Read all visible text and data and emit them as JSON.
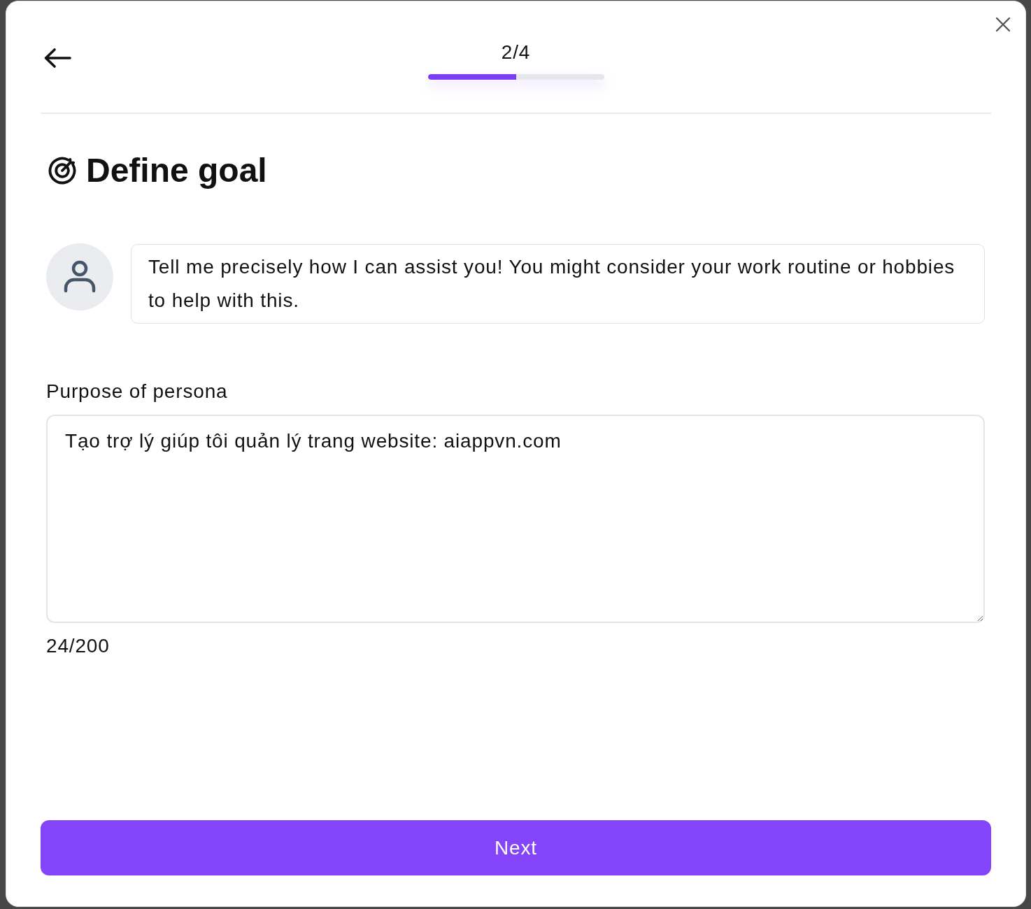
{
  "header": {
    "step": "2/4",
    "progress": {
      "level": 0.5
    }
  },
  "title": "Define goal",
  "assistant_message": "Tell me precisely how I can assist you! You might consider your work routine or hobbies to help with this.",
  "purpose": {
    "label": "Purpose of persona",
    "value": "Tạo trợ lý giúp tôi quản lý trang website: aiappvn.com",
    "counter": "24/200"
  },
  "next_button": {
    "label": "Next"
  }
}
